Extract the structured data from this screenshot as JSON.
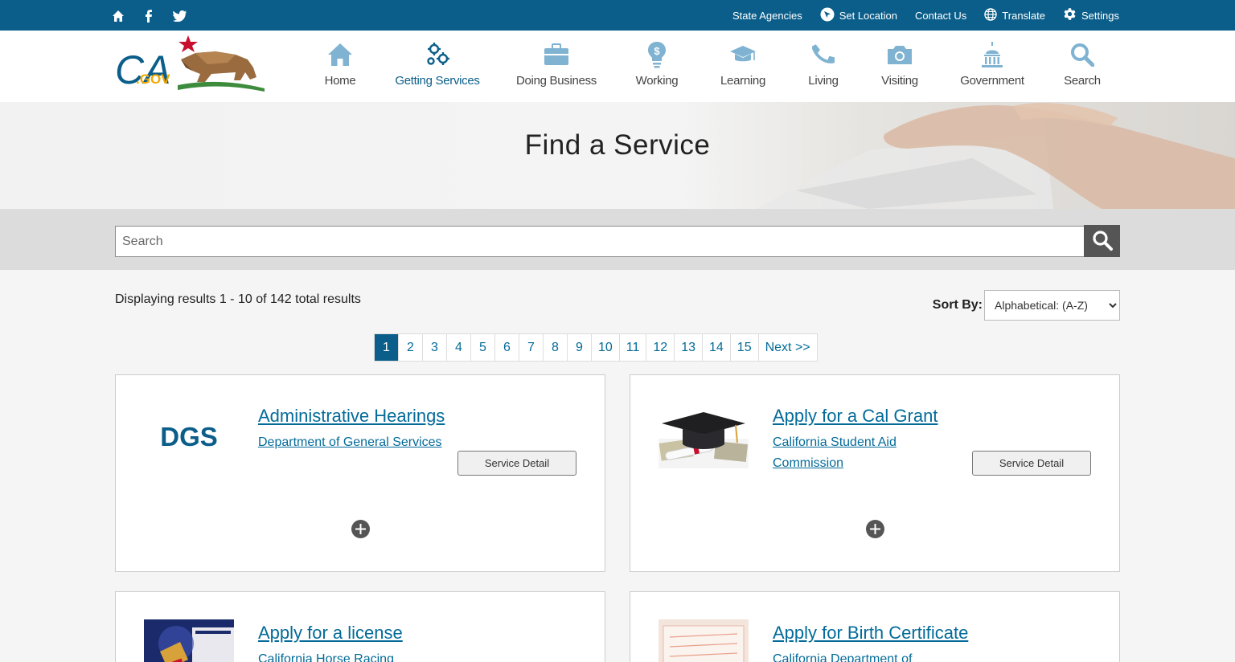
{
  "utility": {
    "links": [
      "State Agencies",
      "Set Location",
      "Contact Us",
      "Translate",
      "Settings"
    ]
  },
  "logo": {
    "text": "CA.GOV"
  },
  "nav": [
    {
      "label": "Home"
    },
    {
      "label": "Getting Services"
    },
    {
      "label": "Doing Business"
    },
    {
      "label": "Working"
    },
    {
      "label": "Learning"
    },
    {
      "label": "Living"
    },
    {
      "label": "Visiting"
    },
    {
      "label": "Government"
    },
    {
      "label": "Search"
    }
  ],
  "hero": {
    "title": "Find a Service"
  },
  "search": {
    "placeholder": "Search"
  },
  "results": {
    "summary": "Displaying results 1 - 10 of 142 total results",
    "sort_label": "Sort By:",
    "sort_value": "Alphabetical: (A-Z)"
  },
  "pager": [
    "1",
    "2",
    "3",
    "4",
    "5",
    "6",
    "7",
    "8",
    "9",
    "10",
    "11",
    "12",
    "13",
    "14",
    "15",
    "Next >>"
  ],
  "cards": [
    {
      "title": "Administrative Hearings",
      "dept": "Department of General Services",
      "button": "Service Detail",
      "logo_text": "DGS"
    },
    {
      "title": "Apply for a Cal Grant",
      "dept": "California Student Aid Commission",
      "button": "Service Detail"
    },
    {
      "title": "Apply for a license",
      "dept": "California Horse Racing"
    },
    {
      "title": "Apply for Birth Certificate",
      "dept": "California Department of"
    }
  ],
  "colors": {
    "utility_bar": "#0b5e8a",
    "link": "#046b99",
    "accent_active": "#0b5e8a"
  }
}
